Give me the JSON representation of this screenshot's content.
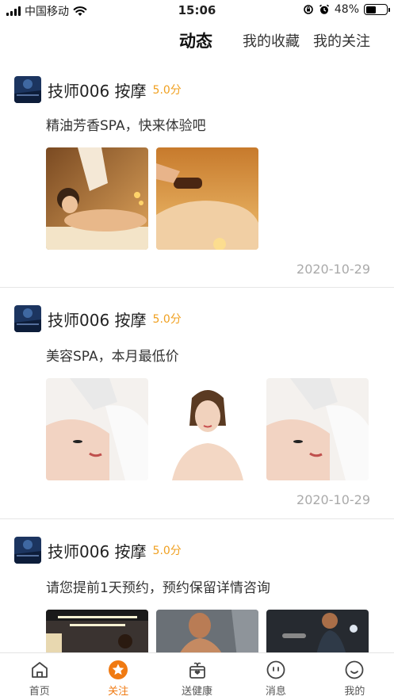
{
  "status_bar": {
    "carrier": "中国移动",
    "time": "15:06",
    "battery": "48%",
    "battery_level": 0.48
  },
  "header": {
    "tabs": [
      {
        "label": "动态",
        "active": true
      },
      {
        "label": "我的收藏",
        "active": false
      },
      {
        "label": "我的关注",
        "active": false
      }
    ]
  },
  "posts": [
    {
      "author": "技师006 按摩",
      "rating": "5.0分",
      "text": "精油芳香SPA，快来体验吧",
      "images": [
        "massage-photo",
        "oil-massage-photo"
      ],
      "date": "2020-10-29"
    },
    {
      "author": "技师006 按摩",
      "rating": "5.0分",
      "text": "美容SPA，本月最低价",
      "images": [
        "facial-photo",
        "beauty-portrait-photo",
        "facial-photo"
      ],
      "date": "2020-10-29"
    },
    {
      "author": "技师006 按摩",
      "rating": "5.0分",
      "text": "请您提前1天预约，预约保留详情咨询",
      "images": [
        "gym-photo",
        "fitness-man-photo",
        "gym-trainer-photo"
      ],
      "date": ""
    }
  ],
  "tabbar": {
    "items": [
      {
        "label": "首页",
        "icon": "home-icon",
        "active": false
      },
      {
        "label": "关注",
        "icon": "star-icon",
        "active": true
      },
      {
        "label": "送健康",
        "icon": "gift-icon",
        "active": false
      },
      {
        "label": "消息",
        "icon": "message-icon",
        "active": false
      },
      {
        "label": "我的",
        "icon": "profile-icon",
        "active": false
      }
    ]
  },
  "colors": {
    "accent": "#f07a12",
    "rating": "#f0a020",
    "date": "#aaaaaa"
  }
}
